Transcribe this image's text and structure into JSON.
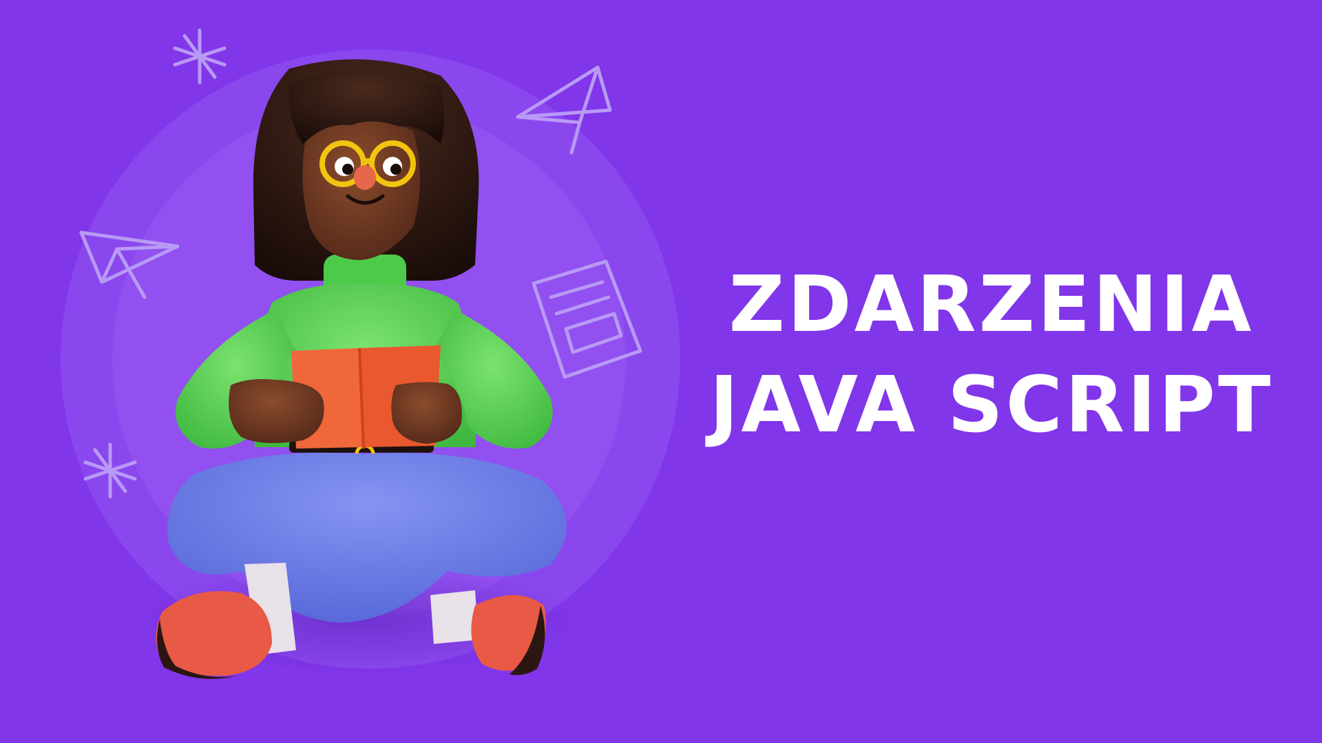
{
  "banner": {
    "headline_line_1": "ZDARZENIA",
    "headline_line_2": "JAVA SCRIPT"
  },
  "colors": {
    "background": "#8136e9",
    "halo_outer": "#8a47ee",
    "halo_inner": "#9150ef",
    "headline_text": "#ffffff",
    "doodle_stroke": "#b89af5",
    "sweater": "#5fd35a",
    "jeans": "#6f7fe8",
    "book": "#f0673c",
    "shoes": "#e85a45",
    "hair": "#2a1510",
    "skin": "#6b3a22",
    "glasses": "#f2c40f"
  },
  "illustration": {
    "subject": "person-reading-book",
    "doodle_icons": [
      "sparkle-icon",
      "paper-plane-icon",
      "paper-plane-icon",
      "document-icon",
      "sparkle-icon"
    ]
  }
}
